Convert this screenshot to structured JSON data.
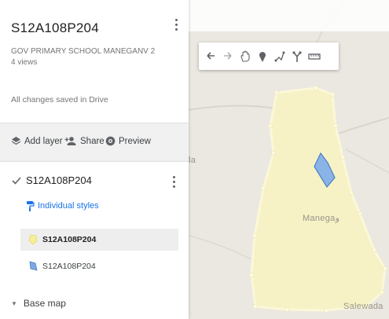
{
  "map": {
    "labels": {
      "manegaon": "Manegaو",
      "salewada": "Salewada",
      "edge": "la"
    },
    "colors": {
      "polygon_fill": "#f6f2c6",
      "polygon_stroke": "#fbf7d9",
      "school_fill": "#8ab4e8",
      "school_stroke": "#4a7fc1"
    }
  },
  "toolbar": {
    "tools": [
      {
        "icon": "undo-icon"
      },
      {
        "icon": "redo-icon"
      },
      {
        "icon": "hand-pan-icon"
      },
      {
        "icon": "add-marker-icon"
      },
      {
        "icon": "draw-line-icon"
      },
      {
        "icon": "directions-icon"
      },
      {
        "icon": "measure-ruler-icon"
      }
    ]
  },
  "panel": {
    "title": "S12A108P204",
    "subtitle": "GOV PRIMARY SCHOOL MANEGANV 2",
    "views": "4 views",
    "save_status": "All changes saved in Drive",
    "actions": {
      "add_layer": "Add layer",
      "share": "Share",
      "preview": "Preview"
    },
    "layer": {
      "name": "S12A108P204",
      "checked": true,
      "styles_label": "Individual styles",
      "features": [
        {
          "name": "S12A108P204",
          "color": "#f6ef9a",
          "selected": true
        },
        {
          "name": "S12A108P204",
          "color": "#7fa9e3",
          "selected": false
        }
      ]
    },
    "base_map": "Base map"
  }
}
